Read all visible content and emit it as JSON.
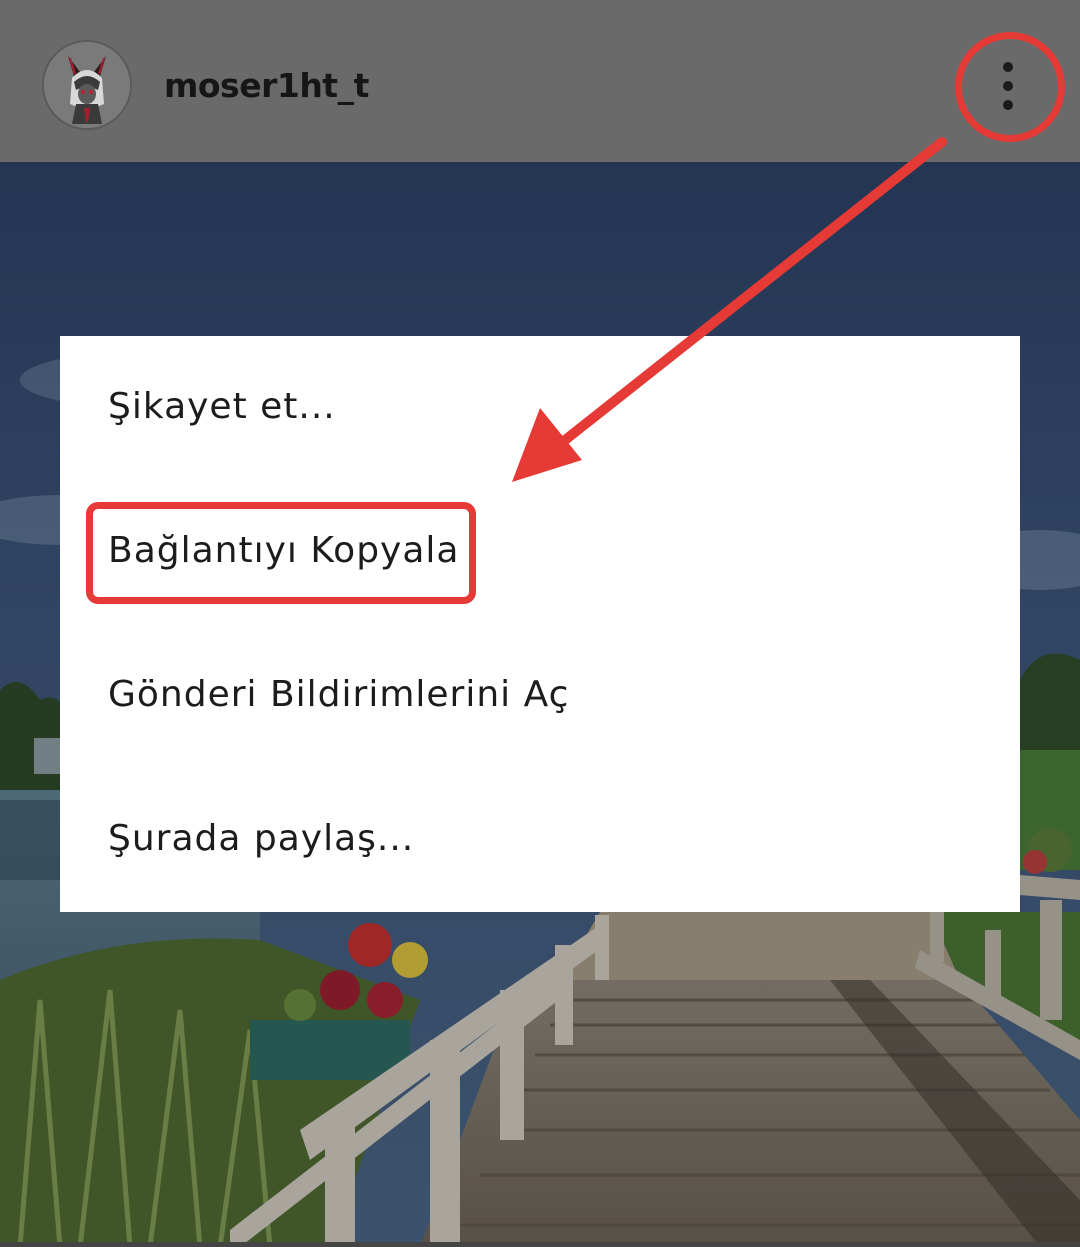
{
  "header": {
    "username": "moser1ht_t",
    "avatar_icon": "horned-character-avatar-icon",
    "more_icon": "more-vertical-icon"
  },
  "menu": {
    "items": [
      {
        "label": "Şikayet et..."
      },
      {
        "label": "Bağlantıyı Kopyala"
      },
      {
        "label": "Gönderi Bildirimlerini Aç"
      },
      {
        "label": "Şurada paylaş..."
      }
    ]
  },
  "colors": {
    "header_background": "#6a6a6a",
    "annotation_red": "#e53a35",
    "menu_background": "#ffffff"
  }
}
